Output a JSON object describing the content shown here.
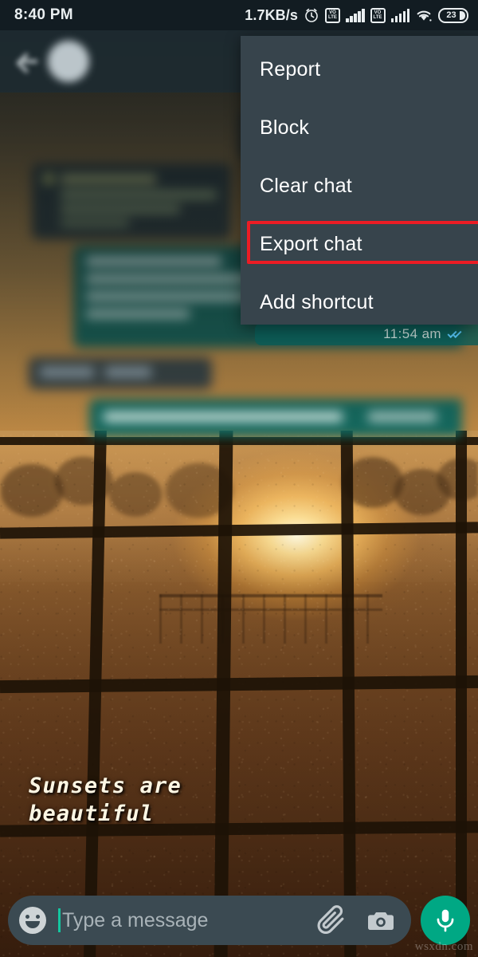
{
  "status_bar": {
    "time": "8:40 PM",
    "network_speed": "1.7KB/s",
    "alarm_icon": "alarm-clock-icon",
    "sim1": {
      "label": "VoLTE",
      "signal_bars": 5
    },
    "sim2": {
      "label": "VoLTE",
      "signal_bars": 5
    },
    "wifi_icon": "wifi-icon",
    "battery_percent": "23"
  },
  "app_bar": {
    "back_icon": "back-arrow-icon",
    "avatar": "contact-avatar",
    "contact_name": ""
  },
  "overflow_menu": {
    "items": [
      {
        "label": "Report",
        "highlighted": false
      },
      {
        "label": "Block",
        "highlighted": false
      },
      {
        "label": "Clear chat",
        "highlighted": false
      },
      {
        "label": "Export chat",
        "highlighted": true
      },
      {
        "label": "Add shortcut",
        "highlighted": false
      }
    ],
    "background_color": "#37444c",
    "highlight_color": "#ec1c24"
  },
  "chat": {
    "last_message_time": "11:54 am",
    "read_receipt": "double-blue-check",
    "outgoing_bubble_color": "#0a5c57",
    "incoming_bubble_color": "#1f2c33"
  },
  "wallpaper": {
    "caption": "Sunsets are\n  beautiful",
    "description": "sunset-through-window-photo"
  },
  "input_bar": {
    "emoji_icon": "smiley-icon",
    "placeholder": "Type a message",
    "value": "",
    "attach_icon": "paperclip-icon",
    "camera_icon": "camera-icon",
    "mic_icon": "microphone-icon",
    "mic_button_color": "#00a884",
    "cursor_color": "#13c7a0"
  },
  "watermark": "wsxdn.com"
}
